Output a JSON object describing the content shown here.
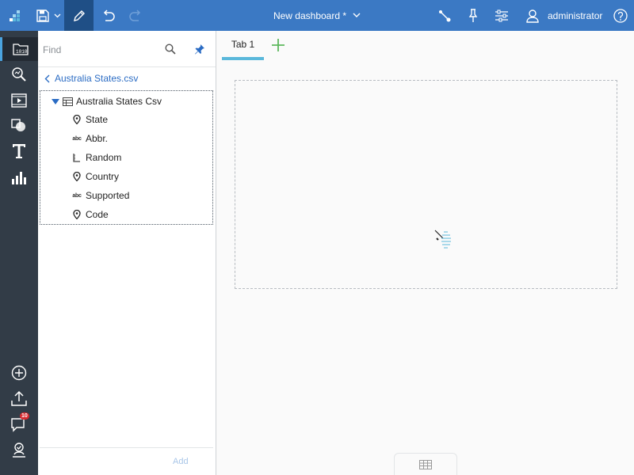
{
  "app": {
    "title": "New dashboard *",
    "user": "administrator",
    "accent": "#3b79c4",
    "rail_color": "#323c47"
  },
  "toolbar": {
    "icons": [
      "app-grid-icon",
      "save-icon",
      "chevron-down-icon",
      "pencil-edit-icon",
      "undo-icon",
      "redo-icon",
      "relationships-icon",
      "pin-icon",
      "properties-sliders-icon",
      "user-icon",
      "help-icon"
    ]
  },
  "rail": {
    "items": [
      "data-sources-icon",
      "explore-icon",
      "media-icon",
      "shapes-icon",
      "text-icon",
      "visualizations-icon",
      "add-icon",
      "upload-icon",
      "comments-icon",
      "my-content-icon"
    ],
    "badge": "10"
  },
  "panel": {
    "find_placeholder": "Find",
    "breadcrumb": "Australia States.csv",
    "source": "Australia States Csv",
    "columns": [
      {
        "label": "State",
        "icon": "geo-pin-icon"
      },
      {
        "label": "Abbr.",
        "icon": "abc-text-icon"
      },
      {
        "label": "Random",
        "icon": "ruler-measure-icon"
      },
      {
        "label": "Country",
        "icon": "geo-pin-icon"
      },
      {
        "label": "Supported",
        "icon": "abc-text-icon"
      },
      {
        "label": "Code",
        "icon": "geo-pin-icon"
      }
    ],
    "add_label": "Add"
  },
  "canvas": {
    "tabs": [
      "Tab 1"
    ],
    "tab_accent": "#5ab8db"
  }
}
